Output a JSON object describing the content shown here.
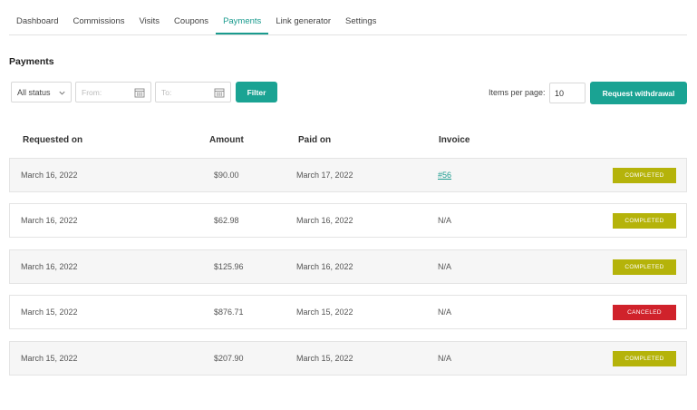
{
  "tabs": [
    {
      "label": "Dashboard",
      "active": false
    },
    {
      "label": "Commissions",
      "active": false
    },
    {
      "label": "Visits",
      "active": false
    },
    {
      "label": "Coupons",
      "active": false
    },
    {
      "label": "Payments",
      "active": true
    },
    {
      "label": "Link generator",
      "active": false
    },
    {
      "label": "Settings",
      "active": false
    }
  ],
  "page_title": "Payments",
  "filters": {
    "status_value": "All status",
    "from_placeholder": "From:",
    "to_placeholder": "To:",
    "filter_label": "Filter"
  },
  "items_per_page": {
    "label": "Items per page:",
    "value": "10"
  },
  "withdraw_label": "Request withdrawal",
  "table": {
    "headers": [
      "Requested on",
      "Amount",
      "Paid on",
      "Invoice"
    ],
    "rows": [
      {
        "requested": "March 16, 2022",
        "amount": "$90.00",
        "paid": "March 17, 2022",
        "invoice": "#56",
        "status": "COMPLETED"
      },
      {
        "requested": "March 16, 2022",
        "amount": "$62.98",
        "paid": "March 16, 2022",
        "invoice": "N/A",
        "status": "COMPLETED"
      },
      {
        "requested": "March 16, 2022",
        "amount": "$125.96",
        "paid": "March 16, 2022",
        "invoice": "N/A",
        "status": "COMPLETED"
      },
      {
        "requested": "March 15, 2022",
        "amount": "$876.71",
        "paid": "March 15, 2022",
        "invoice": "N/A",
        "status": "CANCELED"
      },
      {
        "requested": "March 15, 2022",
        "amount": "$207.90",
        "paid": "March 15, 2022",
        "invoice": "N/A",
        "status": "COMPLETED"
      }
    ]
  },
  "colors": {
    "accent": "#1aa393",
    "completed": "#b5b30a",
    "canceled": "#d0222b"
  },
  "icons": {
    "status_select": "chevron-down-icon",
    "date_field": "calendar-icon"
  }
}
